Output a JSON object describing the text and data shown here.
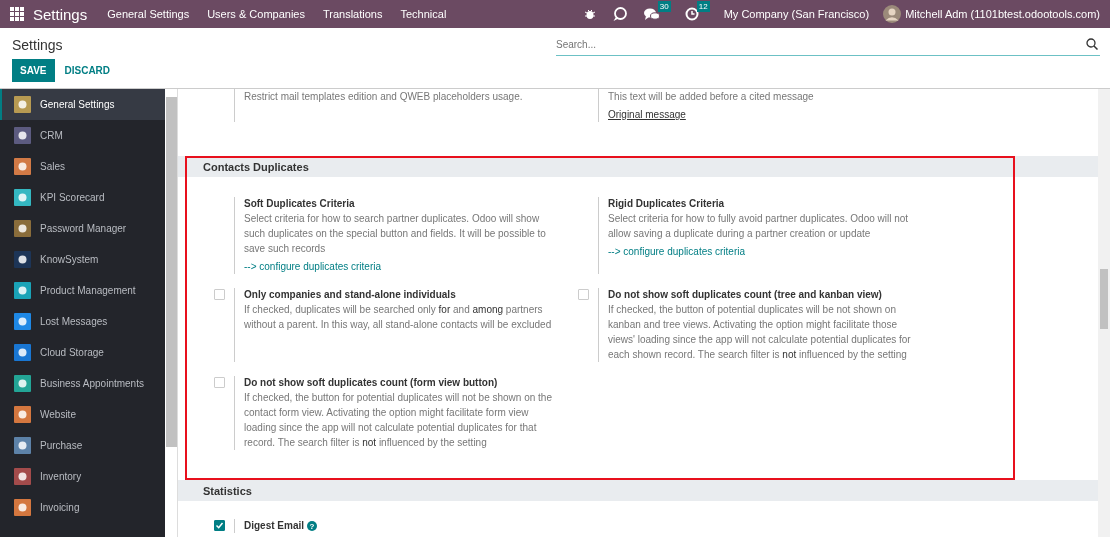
{
  "navbar": {
    "app_title": "Settings",
    "menu": [
      "General Settings",
      "Users & Companies",
      "Translations",
      "Technical"
    ],
    "messages_count": "30",
    "activities_count": "12",
    "company": "My Company (San Francisco)",
    "user": "Mitchell Adm (1101btest.odootools.com)"
  },
  "control_panel": {
    "title": "Settings",
    "search": {
      "placeholder": "Search..."
    },
    "buttons": [
      {
        "label": "SAVE",
        "kind": "primary"
      },
      {
        "label": "DISCARD",
        "kind": "link"
      }
    ]
  },
  "sidebar": {
    "items": [
      {
        "label": "General Settings",
        "selected": true,
        "color": "#b79a52"
      },
      {
        "label": "CRM",
        "selected": false,
        "color": "#5c5b80"
      },
      {
        "label": "Sales",
        "selected": false,
        "color": "#d27a46"
      },
      {
        "label": "KPI Scorecard",
        "selected": false,
        "color": "#34b8c2"
      },
      {
        "label": "Password Manager",
        "selected": false,
        "color": "#8a6d3b"
      },
      {
        "label": "KnowSystem",
        "selected": false,
        "color": "#1d3557"
      },
      {
        "label": "Product Management",
        "selected": false,
        "color": "#1aa3b7"
      },
      {
        "label": "Lost Messages",
        "selected": false,
        "color": "#1e88e5"
      },
      {
        "label": "Cloud Storage",
        "selected": false,
        "color": "#1976d2"
      },
      {
        "label": "Business Appointments",
        "selected": false,
        "color": "#23a596"
      },
      {
        "label": "Website",
        "selected": false,
        "color": "#d4773f"
      },
      {
        "label": "Purchase",
        "selected": false,
        "color": "#5d82a8"
      },
      {
        "label": "Inventory",
        "selected": false,
        "color": "#a34b4b"
      },
      {
        "label": "Invoicing",
        "selected": false,
        "color": "#d4773f"
      }
    ]
  },
  "sections": [
    {
      "settings": [
        {
          "kind": "plain",
          "text": "Restrict mail templates edition and QWEB placeholders usage."
        },
        {
          "kind": "plain",
          "text": "This text will be added before a cited message",
          "link": "Original message"
        }
      ]
    },
    {
      "title": "Contacts Duplicates",
      "highlighted": true,
      "settings": [
        {
          "kind": "plain",
          "title": "Soft Duplicates Criteria",
          "text": "Select criteria for how to search partner duplicates. Odoo will show such duplicates on the special button and fields. It will be possible to save such records",
          "link": "--> configure duplicates criteria"
        },
        {
          "kind": "plain",
          "title": "Rigid Duplicates Criteria",
          "text": "Select criteria for how to fully avoid partner duplicates. Odoo will not allow saving a duplicate during a partner creation or update",
          "link": "--> configure duplicates criteria"
        },
        {
          "kind": "checkbox",
          "checked": false,
          "title": "Only companies and stand-alone individuals",
          "text": "If checked, duplicates will be searched only **for** and **among** partners without a parent. In this way, all stand-alone contacts will be excluded"
        },
        {
          "kind": "checkbox",
          "checked": false,
          "title": "Do not show soft duplicates count (tree and kanban view)",
          "text": "If checked, the button of potential duplicates will be not shown on kanban and tree views. Activating the option might facilitate those views' loading since the app will not calculate potential duplicates for each shown record. The search filter is **not** influenced by the setting"
        },
        {
          "kind": "checkbox",
          "checked": false,
          "title": "Do not show soft duplicates count (form view button)",
          "text": "If checked, the button for potential duplicates will not be shown on the contact form view. Activating the option might facilitate form view loading since the app will not calculate potential duplicates for that record. The search filter is **not** influenced by the setting"
        }
      ]
    },
    {
      "title": "Statistics",
      "highlighted": false,
      "settings": [
        {
          "kind": "checkbox",
          "checked": true,
          "title": "Digest Email",
          "help": "?"
        }
      ]
    }
  ]
}
